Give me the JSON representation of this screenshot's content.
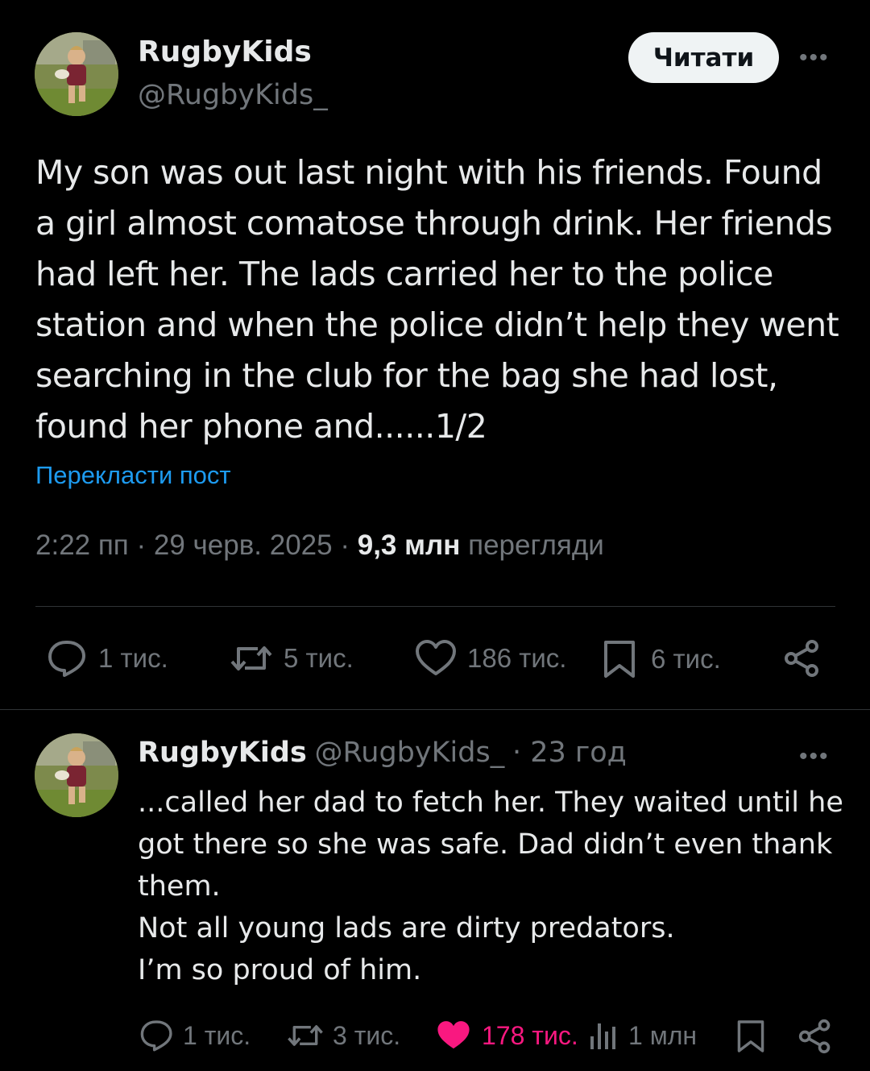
{
  "main_post": {
    "author_name": "RugbyKids",
    "author_handle": "@RugbyKids_",
    "follow_label": "Читати",
    "more_label": "•••",
    "text": "My son was out last night with his friends. Found a girl almost comatose through drink. Her friends had left her. The lads carried her to the police station and when the police didn’t help they went searching in the club for the bag she had lost, found her phone and......1/2",
    "translate_label": "Перекласти пост",
    "time": "2:22 пп",
    "date": "29 черв. 2025",
    "separator": "·",
    "views_count": "9,3 млн",
    "views_label": "перегляди",
    "actions": {
      "replies": "1 тис.",
      "reposts": "5 тис.",
      "likes": "186 тис.",
      "bookmarks": "6 тис."
    }
  },
  "reply_post": {
    "author_name": "RugbyKids",
    "author_handle": "@RugbyKids_",
    "time_ago": "· 23 год",
    "more_label": "•••",
    "text": "...called her dad to fetch her. They waited until he got there so she was safe. Dad didn’t even thank them.\nNot all young lads are dirty predators.\nI’m so proud of him.",
    "actions": {
      "replies": "1 тис.",
      "reposts": "3 тис.",
      "likes": "178 тис.",
      "views": "1 млн"
    },
    "liked": true
  },
  "colors": {
    "background": "#000000",
    "text": "#e7e9ea",
    "secondary": "#71767b",
    "link": "#1d9bf0",
    "like_active": "#f91880",
    "divider": "#2f3336"
  },
  "icons": {
    "avatar": "rugby-player-photo",
    "reply": "speech-bubble-icon",
    "repost": "repost-arrows-icon",
    "like": "heart-icon",
    "bookmark": "bookmark-icon",
    "share": "share-icon",
    "views": "bar-chart-icon"
  }
}
